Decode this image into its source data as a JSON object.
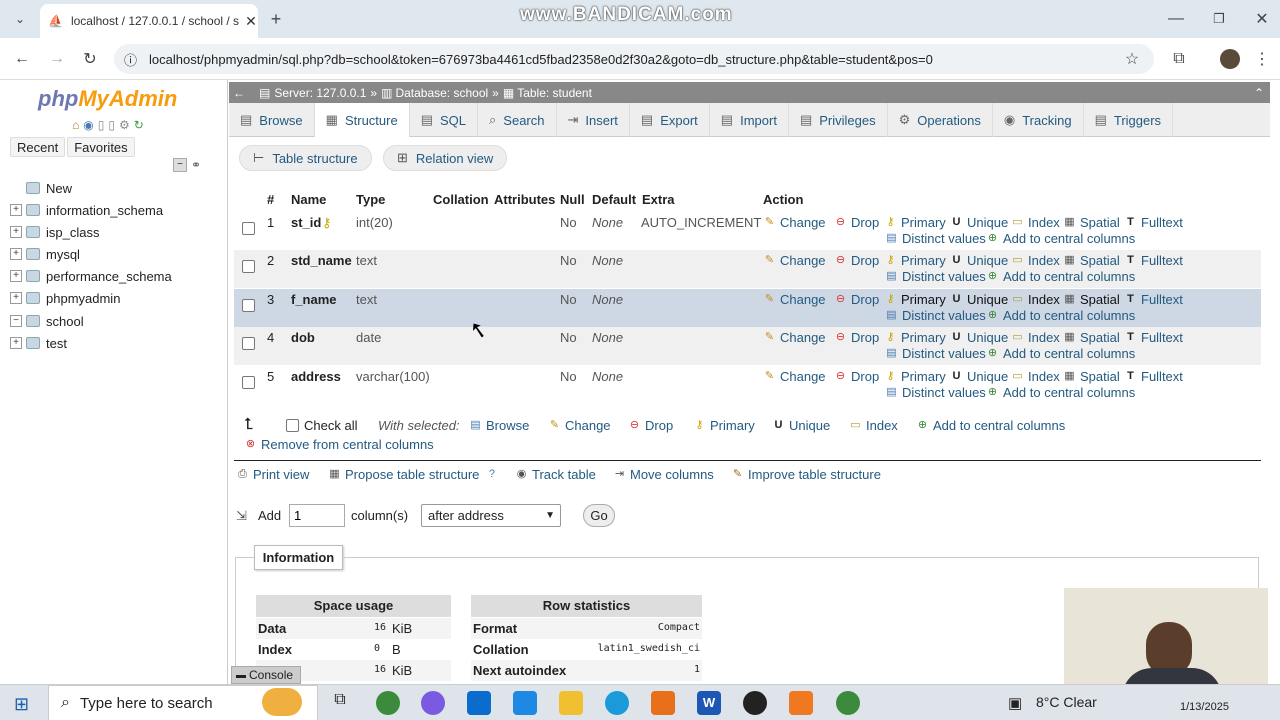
{
  "browser": {
    "tab_title": "localhost / 127.0.0.1 / school / s",
    "url": "localhost/phpmyadmin/sql.php?db=school&token=676973ba4461cd5fbad2358e0d2f30a2&goto=db_structure.php&table=student&pos=0",
    "watermark": "www.BANDICAM.com"
  },
  "left_panel": {
    "logo_php": "php",
    "logo_my": "MyAdmin",
    "recent": "Recent",
    "favorites": "Favorites",
    "tree": [
      {
        "label": "New",
        "expander": ""
      },
      {
        "label": "information_schema",
        "expander": "+"
      },
      {
        "label": "isp_class",
        "expander": "+"
      },
      {
        "label": "mysql",
        "expander": "+"
      },
      {
        "label": "performance_schema",
        "expander": "+"
      },
      {
        "label": "phpmyadmin",
        "expander": "+"
      },
      {
        "label": "school",
        "expander": "−"
      },
      {
        "label": "test",
        "expander": "+"
      }
    ]
  },
  "breadcrumb": {
    "server": "Server: 127.0.0.1",
    "database": "Database: school",
    "table": "Table: student"
  },
  "tabs": [
    "Browse",
    "Structure",
    "SQL",
    "Search",
    "Insert",
    "Export",
    "Import",
    "Privileges",
    "Operations",
    "Tracking",
    "Triggers"
  ],
  "subtabs": [
    "Table structure",
    "Relation view"
  ],
  "columns_header": [
    "#",
    "Name",
    "Type",
    "Collation",
    "Attributes",
    "Null",
    "Default",
    "Extra",
    "Action"
  ],
  "rows": [
    {
      "num": "1",
      "name": "st_id",
      "type": "int(20)",
      "null": "No",
      "default": "None",
      "extra": "AUTO_INCREMENT"
    },
    {
      "num": "2",
      "name": "std_name",
      "type": "text",
      "null": "No",
      "default": "None",
      "extra": ""
    },
    {
      "num": "3",
      "name": "f_name",
      "type": "text",
      "null": "No",
      "default": "None",
      "extra": ""
    },
    {
      "num": "4",
      "name": "dob",
      "type": "date",
      "null": "No",
      "default": "None",
      "extra": ""
    },
    {
      "num": "5",
      "name": "address",
      "type": "varchar(100)",
      "null": "No",
      "default": "None",
      "extra": ""
    }
  ],
  "row_actions": {
    "change": "Change",
    "drop": "Drop",
    "primary": "Primary",
    "unique": "Unique",
    "index": "Index",
    "spatial": "Spatial",
    "fulltext": "Fulltext",
    "distinct": "Distinct values",
    "central": "Add to central columns"
  },
  "bulk": {
    "check_all": "Check all",
    "with_selected": "With selected:",
    "browse": "Browse",
    "change": "Change",
    "drop": "Drop",
    "primary": "Primary",
    "unique": "Unique",
    "index": "Index",
    "add_central": "Add to central columns",
    "remove_central": "Remove from central columns"
  },
  "tools": {
    "print": "Print view",
    "propose": "Propose table structure",
    "track": "Track table",
    "move": "Move columns",
    "improve": "Improve table structure"
  },
  "add_columns": {
    "add": "Add",
    "count": "1",
    "columns_label": "column(s)",
    "position": "after address",
    "go": "Go"
  },
  "information": {
    "title": "Information",
    "space_usage": "Space usage",
    "row_statistics": "Row statistics",
    "space": [
      {
        "label": "Data",
        "value": "16",
        "unit": "KiB"
      },
      {
        "label": "Index",
        "value": "0",
        "unit": "B"
      },
      {
        "label": "",
        "value": "16",
        "unit": "KiB"
      }
    ],
    "stats": [
      {
        "label": "Format",
        "value": "Compact"
      },
      {
        "label": "Collation",
        "value": "latin1_swedish_ci"
      },
      {
        "label": "Next autoindex",
        "value": "1"
      }
    ]
  },
  "console": "Console",
  "taskbar": {
    "search_placeholder": "Type here to search",
    "weather": "8°C",
    "weather_desc": "Clear",
    "date": "1/13/2025"
  }
}
